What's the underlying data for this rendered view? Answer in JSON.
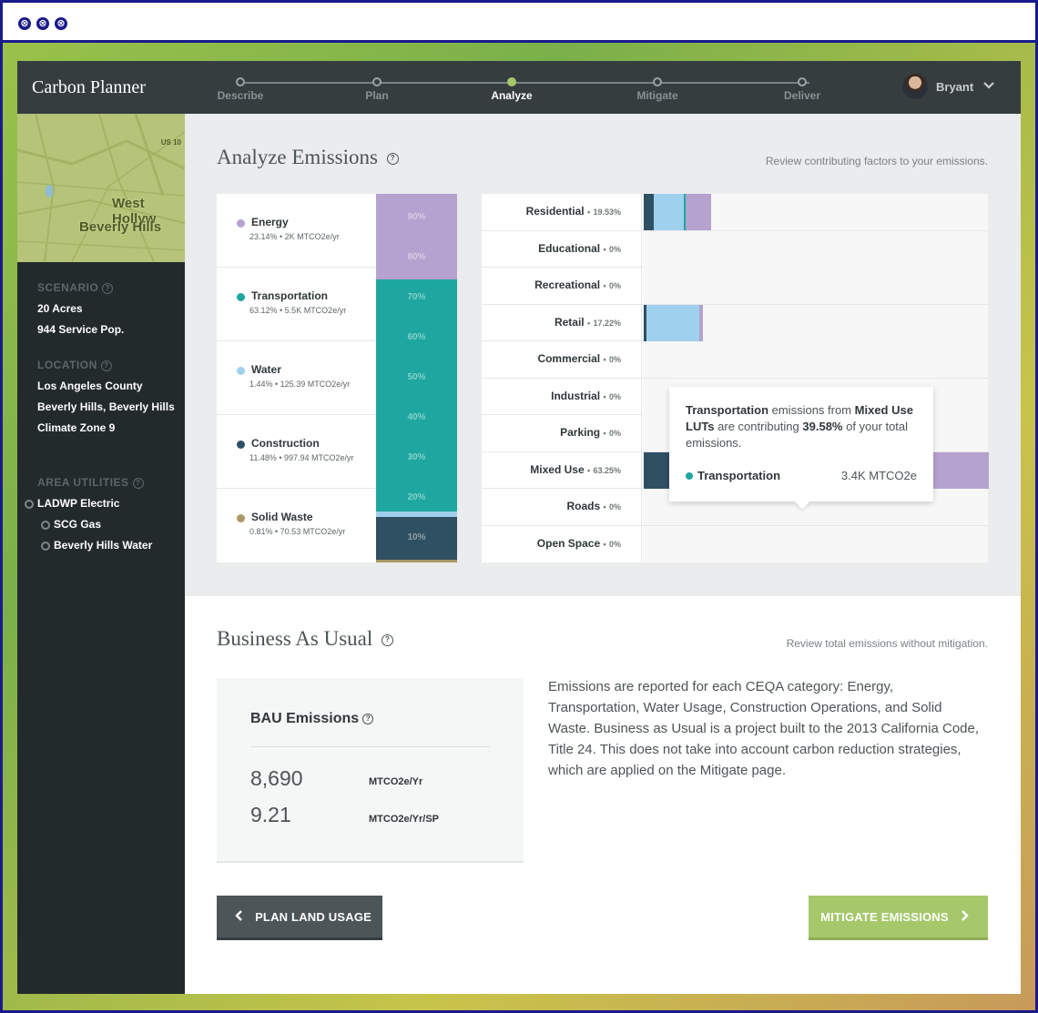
{
  "app": {
    "title": "Carbon Planner"
  },
  "steps": [
    "Describe",
    "Plan",
    "Analyze",
    "Mitigate",
    "Deliver"
  ],
  "active_step": "Analyze",
  "user": {
    "name": "Bryant"
  },
  "map": {
    "label1": "West Hollyw",
    "label2": "Beverly Hills",
    "shield": "US 10"
  },
  "sidebar": {
    "scenario_title": "SCENARIO",
    "scenario_items": [
      "20 Acres",
      "944 Service Pop."
    ],
    "location_title": "LOCATION",
    "location_items": [
      "Los Angeles County",
      "Beverly Hills, Beverly Hills",
      "Climate Zone 9"
    ],
    "utilities_title": "AREA UTILITIES",
    "utilities": [
      "LADWP Electric",
      "SCG Gas",
      "Beverly Hills Water"
    ]
  },
  "analyze": {
    "title": "Analyze Emissions",
    "subtitle": "Review contributing factors to your emissions.",
    "categories": [
      {
        "name": "Energy",
        "meta": "23.14% • 2K MTCO2e/yr",
        "color": "#b5a2cf"
      },
      {
        "name": "Transportation",
        "meta": "63.12% • 5.5K MTCO2e/yr",
        "color": "#1ea79f"
      },
      {
        "name": "Water",
        "meta": "1.44% • 125.39 MTCO2e/yr",
        "color": "#9fd0ee"
      },
      {
        "name": "Construction",
        "meta": "11.48% • 997.94 MTCO2e/yr",
        "color": "#2f4f63"
      },
      {
        "name": "Solid Waste",
        "meta": "0.81% • 70.53 MTCO2e/yr",
        "color": "#a99a66"
      }
    ],
    "stack_pcts": [
      23.14,
      63.12,
      1.44,
      11.48,
      0.81
    ],
    "pct_labels": [
      "90%",
      "80%",
      "70%",
      "60%",
      "50%",
      "40%",
      "30%",
      "20%",
      "10%"
    ],
    "land_uses": [
      {
        "name": "Residential",
        "pct": "19.53%",
        "segments": [
          2.93,
          8.7,
          0.4,
          0,
          7.5
        ]
      },
      {
        "name": "Educational",
        "pct": "0%",
        "segments": [
          0,
          0,
          0,
          0,
          0
        ]
      },
      {
        "name": "Recreational",
        "pct": "0%",
        "segments": [
          0,
          0,
          0,
          0,
          0
        ]
      },
      {
        "name": "Retail",
        "pct": "17.22%",
        "segments": [
          0.8,
          15.2,
          0,
          0,
          1.2
        ]
      },
      {
        "name": "Commercial",
        "pct": "0%",
        "segments": [
          0,
          0,
          0,
          0,
          0
        ]
      },
      {
        "name": "Industrial",
        "pct": "0%",
        "segments": [
          0,
          0,
          0,
          0,
          0
        ]
      },
      {
        "name": "Parking",
        "pct": "0%",
        "segments": [
          0,
          0,
          0,
          0,
          0
        ]
      },
      {
        "name": "Mixed Use",
        "pct": "63.25%",
        "segments": [
          12.9,
          1.6,
          62.8,
          0.4,
          22.3
        ]
      },
      {
        "name": "Roads",
        "pct": "0%",
        "segments": [
          0,
          0,
          0,
          0,
          0
        ]
      },
      {
        "name": "Open Space",
        "pct": "0%",
        "segments": [
          0,
          0,
          0,
          0,
          0
        ]
      }
    ],
    "segment_colors": [
      "#2f4f63",
      "#9fd0ee",
      "#1ea79f",
      "#a99a66",
      "#b5a2cf"
    ],
    "tooltip": {
      "bold1": "Transportation",
      "text1": " emissions from ",
      "bold2": "Mixed Use LUTs",
      "text2": " are contributing ",
      "bold3": "39.58%",
      "text3": " of your total emissions.",
      "series": "Transportation",
      "value": "3.4K MTCO2e"
    }
  },
  "bau": {
    "title": "Business As Usual",
    "subtitle": "Review total emissions without mitigation.",
    "card_title": "BAU Emissions",
    "value1": "8,690",
    "unit1": "MTCO2e/Yr",
    "value2": "9.21",
    "unit2": "MTCO2e/Yr/SP",
    "description": "Emissions are reported for each CEQA category: Energy, Transportation, Water Usage, Construction Operations, and Solid Waste. Business as Usual is a project built to the 2013 California Code, Title 24. This does not take into account carbon reduction strategies, which are applied on the Mitigate page."
  },
  "buttons": {
    "back": "PLAN LAND USAGE",
    "next": "MITIGATE EMISSIONS"
  },
  "window_buttons": [
    "⊗",
    "⊗",
    "⊗"
  ]
}
